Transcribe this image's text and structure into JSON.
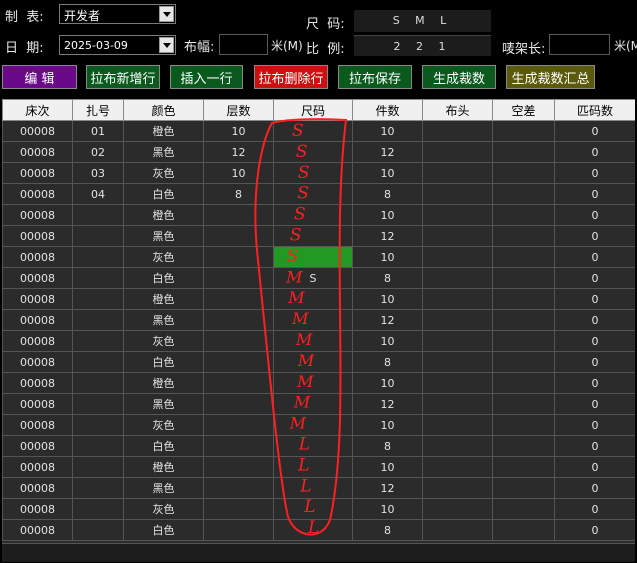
{
  "form": {
    "maker_label": "制  表:",
    "maker_value": "开发者",
    "date_label": "日  期:",
    "date_value": "2025-03-09",
    "width_label": "布幅:",
    "width_unit": "米(M)",
    "ratio_label": "比  例:",
    "size_label": "尺  码:",
    "size_value": "S M L",
    "ratio_value": "2 2 1",
    "rack_label": "唛架长:",
    "rack_unit": "米(M)"
  },
  "toolbar": {
    "edit": "编    辑",
    "add_row": "拉布新增行",
    "insert_row": "插入一行",
    "delete_row": "拉布删除行",
    "save": "拉布保存",
    "gen_cut": "生成裁数",
    "gen_cut_summary": "生成裁数汇总"
  },
  "colors": {
    "edit_bg": "#6a0a8a",
    "add_row_bg": "#0a5a1e",
    "insert_row_bg": "#0a5a1e",
    "delete_row_bg": "#cc1010",
    "save_bg": "#0a5a1e",
    "gen_cut_bg": "#0a5a1e",
    "gen_cut_summary_bg": "#5a5a0a",
    "selection": "#229922",
    "annotation": "#ff2020"
  },
  "table": {
    "columns": [
      "床次",
      "扎号",
      "颜色",
      "层数",
      "尺码",
      "件数",
      "布头",
      "空差",
      "匹码数"
    ],
    "rows": [
      [
        "00008",
        "01",
        "橙色",
        "10",
        "",
        "10",
        "",
        "",
        "0"
      ],
      [
        "00008",
        "02",
        "黑色",
        "12",
        "",
        "12",
        "",
        "",
        "0"
      ],
      [
        "00008",
        "03",
        "灰色",
        "10",
        "",
        "10",
        "",
        "",
        "0"
      ],
      [
        "00008",
        "04",
        "白色",
        "8",
        "",
        "8",
        "",
        "",
        "0"
      ],
      [
        "00008",
        "",
        "橙色",
        "",
        "",
        "10",
        "",
        "",
        "0"
      ],
      [
        "00008",
        "",
        "黑色",
        "",
        "",
        "12",
        "",
        "",
        "0"
      ],
      [
        "00008",
        "",
        "灰色",
        "",
        "",
        "10",
        "",
        "",
        "0"
      ],
      [
        "00008",
        "",
        "白色",
        "",
        "S",
        "8",
        "",
        "",
        "0"
      ],
      [
        "00008",
        "",
        "橙色",
        "",
        "",
        "10",
        "",
        "",
        "0"
      ],
      [
        "00008",
        "",
        "黑色",
        "",
        "",
        "12",
        "",
        "",
        "0"
      ],
      [
        "00008",
        "",
        "灰色",
        "",
        "",
        "10",
        "",
        "",
        "0"
      ],
      [
        "00008",
        "",
        "白色",
        "",
        "",
        "8",
        "",
        "",
        "0"
      ],
      [
        "00008",
        "",
        "橙色",
        "",
        "",
        "10",
        "",
        "",
        "0"
      ],
      [
        "00008",
        "",
        "黑色",
        "",
        "",
        "12",
        "",
        "",
        "0"
      ],
      [
        "00008",
        "",
        "灰色",
        "",
        "",
        "10",
        "",
        "",
        "0"
      ],
      [
        "00008",
        "",
        "白色",
        "",
        "",
        "8",
        "",
        "",
        "0"
      ],
      [
        "00008",
        "",
        "橙色",
        "",
        "",
        "10",
        "",
        "",
        "0"
      ],
      [
        "00008",
        "",
        "黑色",
        "",
        "",
        "12",
        "",
        "",
        "0"
      ],
      [
        "00008",
        "",
        "灰色",
        "",
        "",
        "10",
        "",
        "",
        "0"
      ],
      [
        "00008",
        "",
        "白色",
        "",
        "",
        "8",
        "",
        "",
        "0"
      ]
    ],
    "selected_cell": {
      "row": 6,
      "col": 4
    }
  },
  "annotation": {
    "handwritten_marks": [
      "S",
      "S",
      "S",
      "S",
      "S",
      "S",
      "S",
      "M",
      "M",
      "M",
      "M",
      "M",
      "M",
      "M",
      "M",
      "L",
      "L",
      "L",
      "L",
      "L"
    ]
  }
}
